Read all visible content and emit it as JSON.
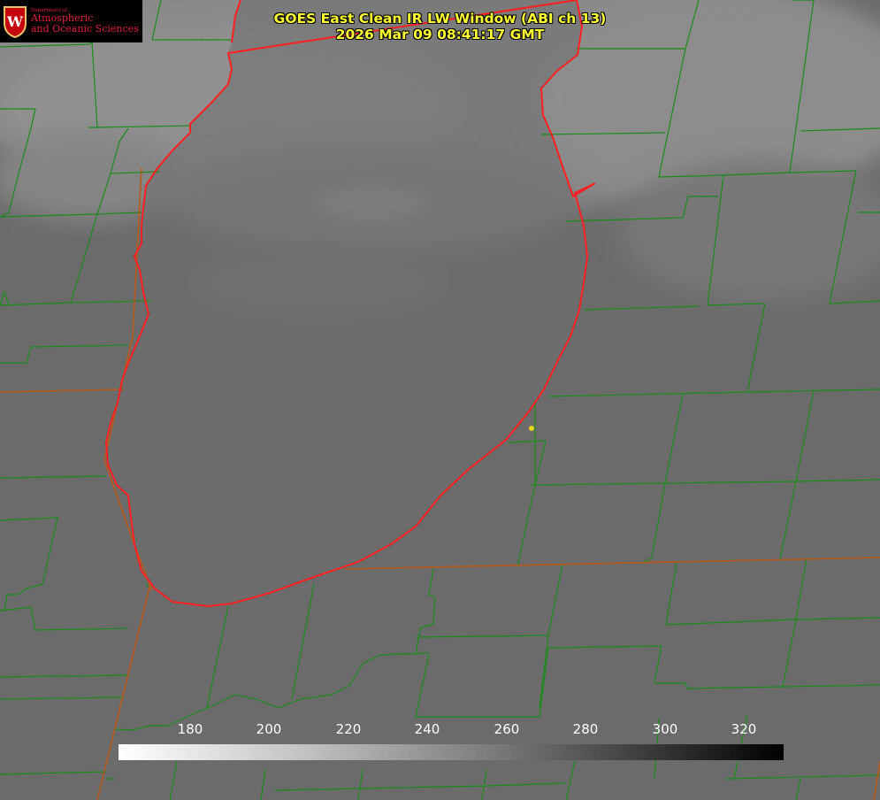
{
  "header": {
    "title": "GOES East Clean IR LW Window (ABI ch 13)",
    "timestamp": "2026 Mar 09 08:41:17 GMT"
  },
  "logo": {
    "department": "Department of",
    "line1": "Atmospheric",
    "line2": "and Oceanic Sciences",
    "crest_letter": "W",
    "color": "#e0203a"
  },
  "colorbar": {
    "ticks": [
      "180",
      "200",
      "220",
      "240",
      "260",
      "280",
      "300",
      "320"
    ],
    "scale": "grayscale, white (cold) to black (warm)"
  },
  "colors": {
    "background": "#6b6b6b",
    "county_lines": "#1a8c1a",
    "state_lines": "#b85a1a",
    "lake_shoreline": "#ff2020",
    "title_text": "#ffff33",
    "city_marker": "#e8d21a"
  }
}
